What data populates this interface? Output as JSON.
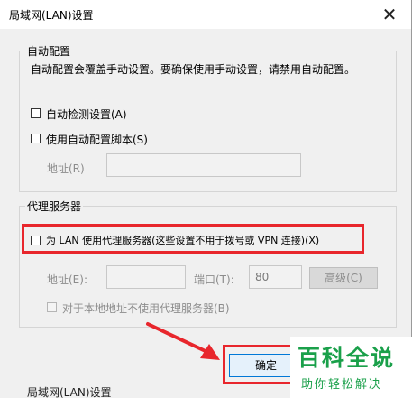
{
  "window": {
    "title": "局域网(LAN)设置",
    "close_glyph": "✕"
  },
  "auto_config": {
    "legend": "自动配置",
    "description": "自动配置会覆盖手动设置。要确保使用手动设置，请禁用自动配置。",
    "auto_detect_label": "自动检测设置(A)",
    "auto_detect_checked": false,
    "use_script_label": "使用自动配置脚本(S)",
    "use_script_checked": false,
    "address_label": "地址(R)",
    "address_value": ""
  },
  "proxy": {
    "legend": "代理服务器",
    "use_proxy_label": "为 LAN 使用代理服务器(这些设置不用于拨号或 VPN 连接)(X)",
    "use_proxy_checked": false,
    "address_label": "地址(E):",
    "address_value": "",
    "port_label": "端口(T):",
    "port_value": "80",
    "advanced_label": "高级(C)",
    "bypass_local_label": "对于本地地址不使用代理服务器(B)",
    "bypass_local_checked": false
  },
  "buttons": {
    "ok_label": "确定"
  },
  "watermark": {
    "main": "百科全说",
    "sub": "助你轻松解决"
  },
  "background_window": {
    "title": "局域网(LAN)设置"
  },
  "colors": {
    "highlight": "#e8262c",
    "watermark": "#1aa04a"
  }
}
